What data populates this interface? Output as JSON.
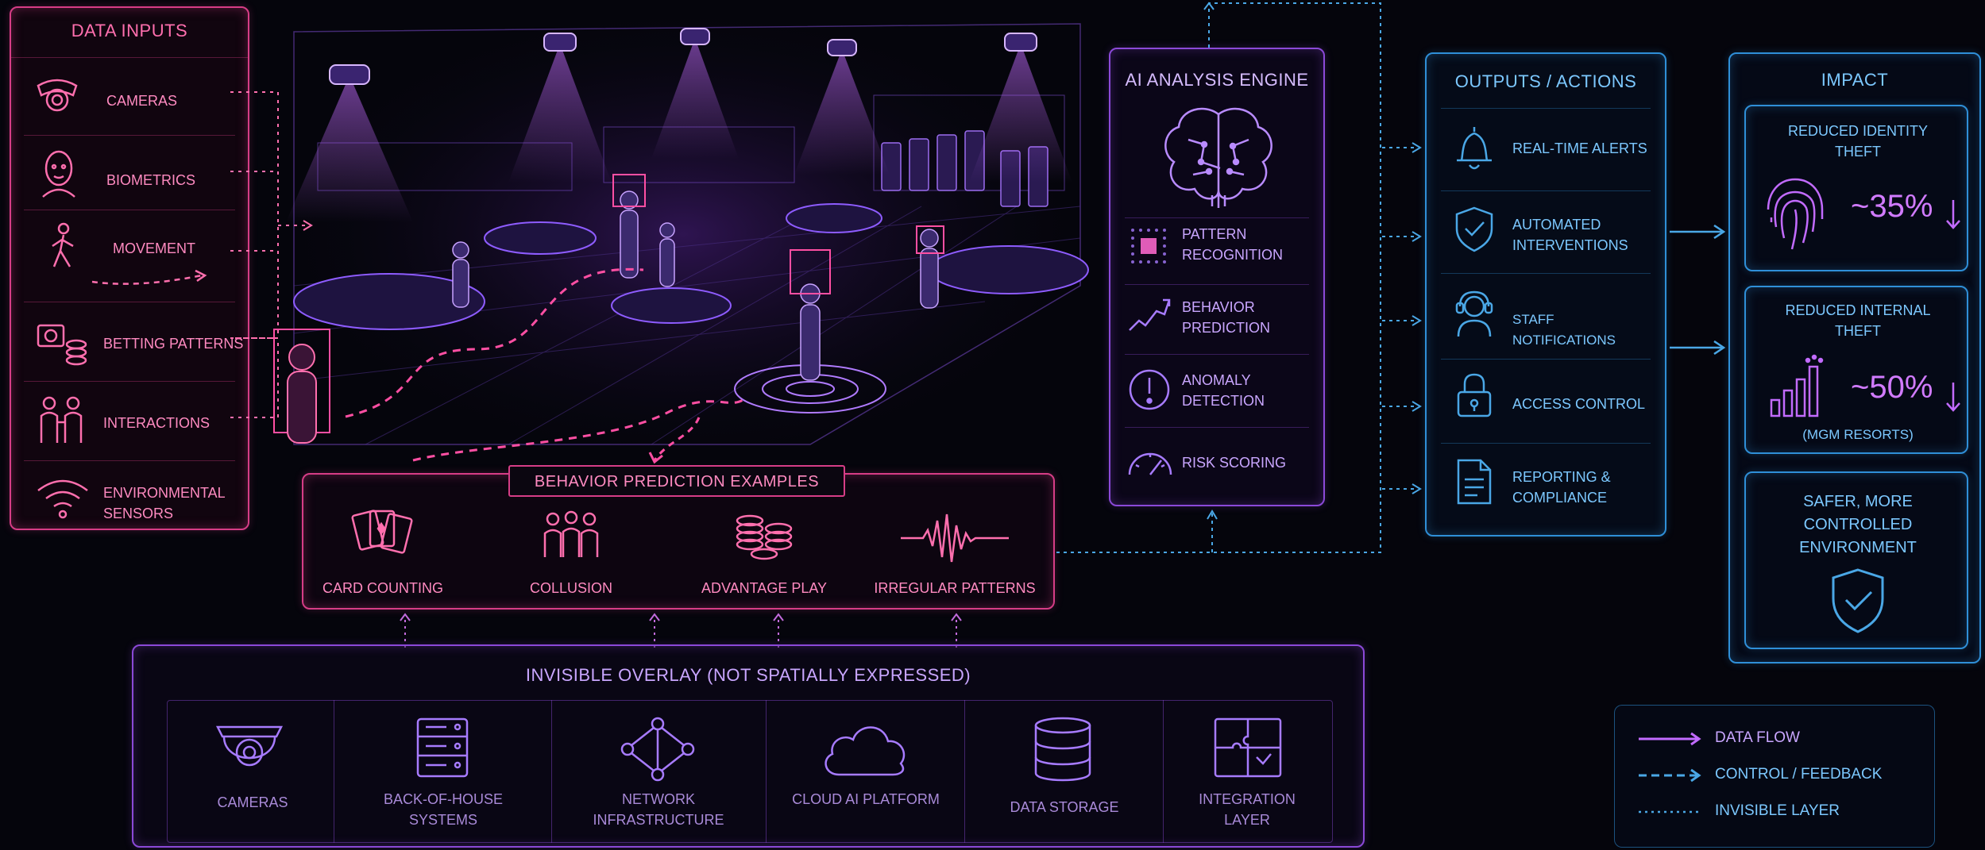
{
  "colors": {
    "pink": "#d63d86",
    "violet": "#8b49d8",
    "blue": "#2f8fd8",
    "text_pink": "#ff6fae",
    "text_violet": "#c9a6ff",
    "text_blue": "#7cc8ff"
  },
  "data_inputs": {
    "title": "DATA INPUTS",
    "items": [
      {
        "label": "CAMERAS",
        "icon": "camera-icon"
      },
      {
        "label": "BIOMETRICS",
        "icon": "face-icon"
      },
      {
        "label": "MOVEMENT",
        "icon": "walking-person-icon"
      },
      {
        "label": "BETTING PATTERNS",
        "icon": "chips-icon"
      },
      {
        "label": "INTERACTIONS",
        "icon": "people-icon"
      },
      {
        "label": "ENVIRONMENTAL SENSORS",
        "icon": "wifi-sensor-icon"
      }
    ]
  },
  "behavior_examples": {
    "title": "BEHAVIOR PREDICTION EXAMPLES",
    "items": [
      {
        "label": "CARD COUNTING",
        "icon": "cards-icon"
      },
      {
        "label": "COLLUSION",
        "icon": "group-icon"
      },
      {
        "label": "ADVANTAGE PLAY",
        "icon": "chip-stack-icon"
      },
      {
        "label": "IRREGULAR PATTERNS",
        "icon": "waveform-icon"
      }
    ]
  },
  "ai_engine": {
    "title": "AI ANALYSIS ENGINE",
    "items": [
      {
        "label": "PATTERN RECOGNITION",
        "icon": "grid-icon"
      },
      {
        "label": "BEHAVIOR PREDICTION",
        "icon": "trend-icon"
      },
      {
        "label": "ANOMALY DETECTION",
        "icon": "alert-icon"
      },
      {
        "label": "RISK SCORING",
        "icon": "gauge-icon"
      }
    ]
  },
  "outputs": {
    "title": "OUTPUTS / ACTIONS",
    "items": [
      {
        "label": "REAL-TIME ALERTS",
        "icon": "bell-icon"
      },
      {
        "label": "AUTOMATED INTERVENTIONS",
        "icon": "shield-check-icon"
      },
      {
        "label": "STAFF NOTIFICATIONS",
        "icon": "headset-icon"
      },
      {
        "label": "ACCESS CONTROL",
        "icon": "lock-icon"
      },
      {
        "label": "REPORTING & COMPLIANCE",
        "icon": "document-icon"
      }
    ]
  },
  "impact": {
    "title": "IMPACT",
    "cards": [
      {
        "title": "REDUCED IDENTITY THEFT",
        "value": "~35%",
        "icon": "fingerprint-icon",
        "arrow": "down-arrow-icon",
        "note": ""
      },
      {
        "title": "REDUCED INTERNAL THEFT",
        "value": "~50%",
        "icon": "bar-chart-icon",
        "arrow": "down-arrow-icon",
        "note": "(MGM RESORTS)"
      },
      {
        "title": "SAFER, MORE CONTROLLED ENVIRONMENT",
        "value": "",
        "icon": "shield-check-icon",
        "arrow": "",
        "note": ""
      }
    ]
  },
  "overlay": {
    "title": "INVISIBLE OVERLAY (NOT SPATIALLY EXPRESSED)",
    "items": [
      {
        "label": "CAMERAS",
        "icon": "dome-camera-icon"
      },
      {
        "label": "BACK-OF-HOUSE SYSTEMS",
        "icon": "server-icon"
      },
      {
        "label": "NETWORK INFRASTRUCTURE",
        "icon": "network-icon"
      },
      {
        "label": "CLOUD AI PLATFORM",
        "icon": "cloud-icon"
      },
      {
        "label": "DATA STORAGE",
        "icon": "database-icon"
      },
      {
        "label": "INTEGRATION LAYER",
        "icon": "puzzle-icon"
      }
    ]
  },
  "legend": {
    "items": [
      {
        "label": "DATA FLOW",
        "style": "solid"
      },
      {
        "label": "CONTROL / FEEDBACK",
        "style": "dashed"
      },
      {
        "label": "INVISIBLE LAYER",
        "style": "dotted"
      }
    ]
  }
}
